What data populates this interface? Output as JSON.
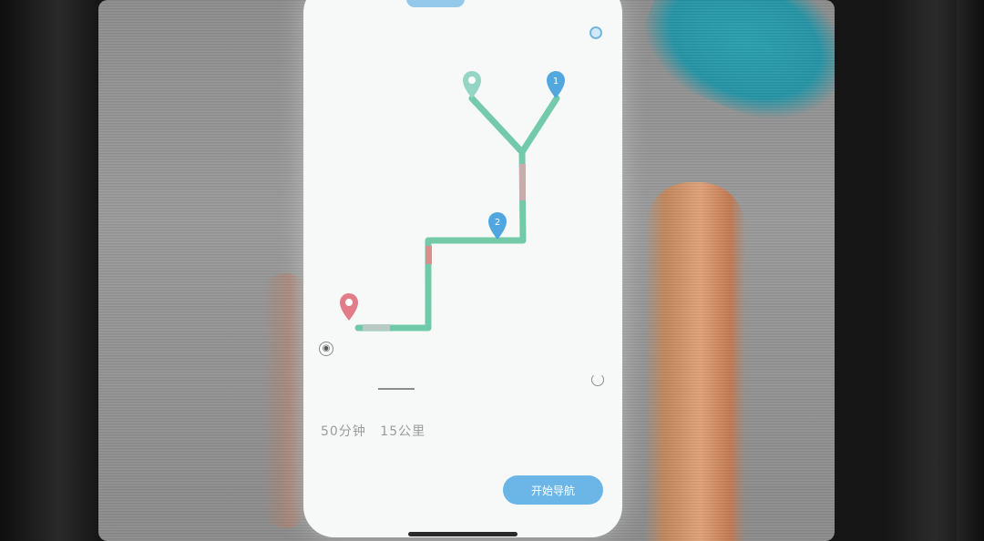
{
  "summary": {
    "duration": "50分钟",
    "distance": "15公里"
  },
  "actions": {
    "start_label": "开始导航"
  },
  "markers": {
    "stop_1": "1",
    "stop_2": "2"
  },
  "icons": {
    "locate": "crosshair-icon",
    "refresh": "refresh-icon"
  },
  "colors": {
    "route_green": "#6dc8a6",
    "marker_blue": "#4aa3dd",
    "marker_origin": "#e07a86",
    "marker_dest": "#8fd3c1",
    "button_blue": "#6ab6e6"
  }
}
